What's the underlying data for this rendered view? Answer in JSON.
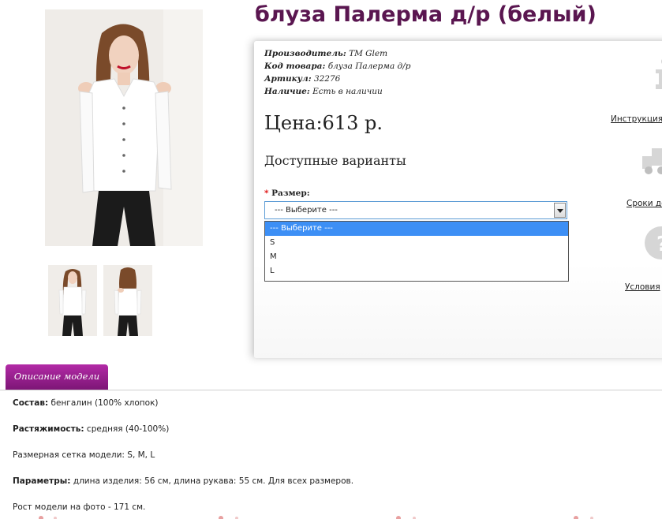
{
  "product": {
    "title": "блуза Палерма д/р (белый)"
  },
  "meta": {
    "manufacturer_label": "Производитель:",
    "manufacturer_value": "TM Glem",
    "code_label": "Код товара:",
    "code_value": "блуза Палерма д/р",
    "sku_label": "Артикул:",
    "sku_value": "32276",
    "stock_label": "Наличие:",
    "stock_value": "Есть в наличии"
  },
  "price": "Цена:613 р.",
  "variants_heading": "Доступные варианты",
  "size": {
    "required_mark": "*",
    "label": "Размер:",
    "selected": "--- Выберите ---",
    "options": [
      "--- Выберите ---",
      "S",
      "M",
      "L"
    ]
  },
  "side_links": {
    "instructions": "Инструкция",
    "delivery": "Сроки до",
    "terms": "Условия"
  },
  "tabs": {
    "description": "Описание модели"
  },
  "description": [
    {
      "label": "Состав:",
      "value": " бенгалин (100% хлопок)"
    },
    {
      "label": "Растяжимость:",
      "value": " средняя (40-100%)"
    },
    {
      "label": "",
      "value": "Размерная сетка модели: S, M, L"
    },
    {
      "label": "Параметры:",
      "value": " длина изделия: 56 см, длина рукава: 55 см. Для всех размеров."
    },
    {
      "label": "",
      "value": "Рост модели на фото - 171 см."
    }
  ],
  "colors": {
    "title": "#5a1650",
    "tab": "#9b2094",
    "select_border": "#5b9bd5",
    "option_highlight": "#3d8ff5"
  }
}
